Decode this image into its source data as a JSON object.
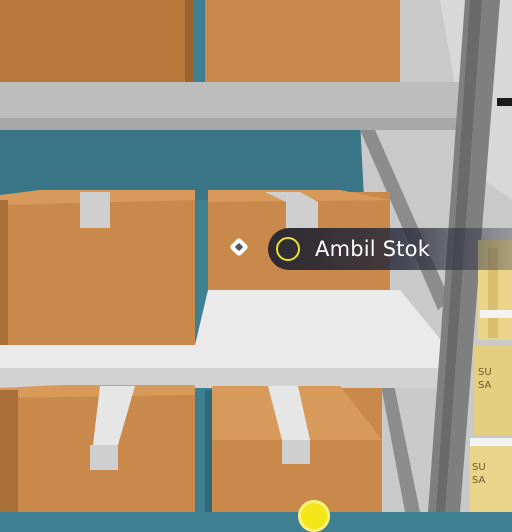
{
  "interaction_prompt": {
    "label": "Ambil Stok",
    "key_icon": "circle-button-icon",
    "key_color": "#e8e22a"
  },
  "crosshair": {
    "icon": "diamond-crosshair-icon"
  },
  "box_labels": [
    "SU",
    "SA",
    "SU",
    "SA"
  ],
  "colors": {
    "box": "#c8894a",
    "shelf": "#e6e6e6",
    "rack": "#8a8a8a",
    "background": "#3e7f92"
  }
}
